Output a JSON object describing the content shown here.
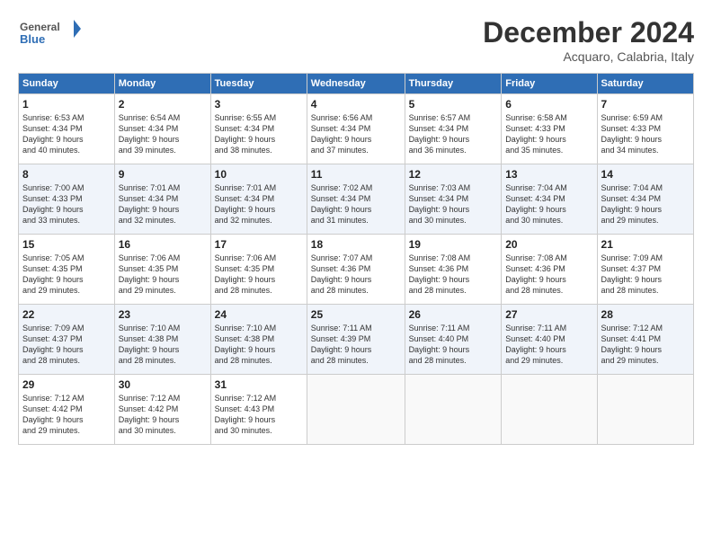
{
  "header": {
    "logo_line1": "General",
    "logo_line2": "Blue",
    "month": "December 2024",
    "location": "Acquaro, Calabria, Italy"
  },
  "days_of_week": [
    "Sunday",
    "Monday",
    "Tuesday",
    "Wednesday",
    "Thursday",
    "Friday",
    "Saturday"
  ],
  "weeks": [
    [
      {
        "day": "1",
        "info": "Sunrise: 6:53 AM\nSunset: 4:34 PM\nDaylight: 9 hours\nand 40 minutes."
      },
      {
        "day": "2",
        "info": "Sunrise: 6:54 AM\nSunset: 4:34 PM\nDaylight: 9 hours\nand 39 minutes."
      },
      {
        "day": "3",
        "info": "Sunrise: 6:55 AM\nSunset: 4:34 PM\nDaylight: 9 hours\nand 38 minutes."
      },
      {
        "day": "4",
        "info": "Sunrise: 6:56 AM\nSunset: 4:34 PM\nDaylight: 9 hours\nand 37 minutes."
      },
      {
        "day": "5",
        "info": "Sunrise: 6:57 AM\nSunset: 4:34 PM\nDaylight: 9 hours\nand 36 minutes."
      },
      {
        "day": "6",
        "info": "Sunrise: 6:58 AM\nSunset: 4:33 PM\nDaylight: 9 hours\nand 35 minutes."
      },
      {
        "day": "7",
        "info": "Sunrise: 6:59 AM\nSunset: 4:33 PM\nDaylight: 9 hours\nand 34 minutes."
      }
    ],
    [
      {
        "day": "8",
        "info": "Sunrise: 7:00 AM\nSunset: 4:33 PM\nDaylight: 9 hours\nand 33 minutes."
      },
      {
        "day": "9",
        "info": "Sunrise: 7:01 AM\nSunset: 4:34 PM\nDaylight: 9 hours\nand 32 minutes."
      },
      {
        "day": "10",
        "info": "Sunrise: 7:01 AM\nSunset: 4:34 PM\nDaylight: 9 hours\nand 32 minutes."
      },
      {
        "day": "11",
        "info": "Sunrise: 7:02 AM\nSunset: 4:34 PM\nDaylight: 9 hours\nand 31 minutes."
      },
      {
        "day": "12",
        "info": "Sunrise: 7:03 AM\nSunset: 4:34 PM\nDaylight: 9 hours\nand 30 minutes."
      },
      {
        "day": "13",
        "info": "Sunrise: 7:04 AM\nSunset: 4:34 PM\nDaylight: 9 hours\nand 30 minutes."
      },
      {
        "day": "14",
        "info": "Sunrise: 7:04 AM\nSunset: 4:34 PM\nDaylight: 9 hours\nand 29 minutes."
      }
    ],
    [
      {
        "day": "15",
        "info": "Sunrise: 7:05 AM\nSunset: 4:35 PM\nDaylight: 9 hours\nand 29 minutes."
      },
      {
        "day": "16",
        "info": "Sunrise: 7:06 AM\nSunset: 4:35 PM\nDaylight: 9 hours\nand 29 minutes."
      },
      {
        "day": "17",
        "info": "Sunrise: 7:06 AM\nSunset: 4:35 PM\nDaylight: 9 hours\nand 28 minutes."
      },
      {
        "day": "18",
        "info": "Sunrise: 7:07 AM\nSunset: 4:36 PM\nDaylight: 9 hours\nand 28 minutes."
      },
      {
        "day": "19",
        "info": "Sunrise: 7:08 AM\nSunset: 4:36 PM\nDaylight: 9 hours\nand 28 minutes."
      },
      {
        "day": "20",
        "info": "Sunrise: 7:08 AM\nSunset: 4:36 PM\nDaylight: 9 hours\nand 28 minutes."
      },
      {
        "day": "21",
        "info": "Sunrise: 7:09 AM\nSunset: 4:37 PM\nDaylight: 9 hours\nand 28 minutes."
      }
    ],
    [
      {
        "day": "22",
        "info": "Sunrise: 7:09 AM\nSunset: 4:37 PM\nDaylight: 9 hours\nand 28 minutes."
      },
      {
        "day": "23",
        "info": "Sunrise: 7:10 AM\nSunset: 4:38 PM\nDaylight: 9 hours\nand 28 minutes."
      },
      {
        "day": "24",
        "info": "Sunrise: 7:10 AM\nSunset: 4:38 PM\nDaylight: 9 hours\nand 28 minutes."
      },
      {
        "day": "25",
        "info": "Sunrise: 7:11 AM\nSunset: 4:39 PM\nDaylight: 9 hours\nand 28 minutes."
      },
      {
        "day": "26",
        "info": "Sunrise: 7:11 AM\nSunset: 4:40 PM\nDaylight: 9 hours\nand 28 minutes."
      },
      {
        "day": "27",
        "info": "Sunrise: 7:11 AM\nSunset: 4:40 PM\nDaylight: 9 hours\nand 29 minutes."
      },
      {
        "day": "28",
        "info": "Sunrise: 7:12 AM\nSunset: 4:41 PM\nDaylight: 9 hours\nand 29 minutes."
      }
    ],
    [
      {
        "day": "29",
        "info": "Sunrise: 7:12 AM\nSunset: 4:42 PM\nDaylight: 9 hours\nand 29 minutes."
      },
      {
        "day": "30",
        "info": "Sunrise: 7:12 AM\nSunset: 4:42 PM\nDaylight: 9 hours\nand 30 minutes."
      },
      {
        "day": "31",
        "info": "Sunrise: 7:12 AM\nSunset: 4:43 PM\nDaylight: 9 hours\nand 30 minutes."
      },
      null,
      null,
      null,
      null
    ]
  ]
}
